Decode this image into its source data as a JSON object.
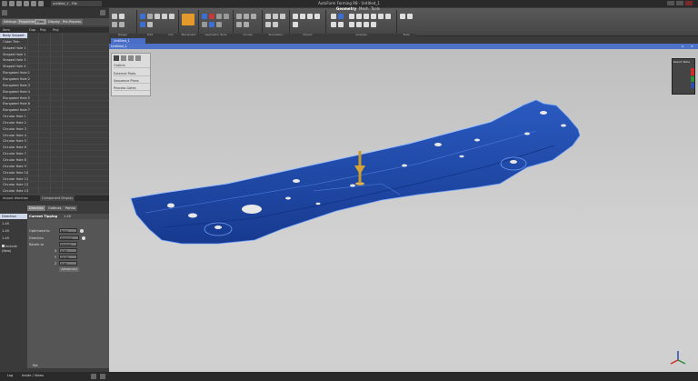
{
  "window": {
    "title": "AutoForm Forming R8 - Untitled_1",
    "quick_tab": "untitled_1 - File"
  },
  "ribbon": {
    "menus": [
      "Geometry",
      "Mesh",
      "Tools"
    ],
    "groups": [
      "Design",
      "Edit",
      "Cut",
      "Placement",
      "Geometric Tools",
      "Curves",
      "Simulation",
      "Import",
      "Analysis",
      "Tools"
    ]
  },
  "left_panel": {
    "tabs": [
      "Settings",
      "Properties",
      "Filter",
      "Display",
      "Pre-Process"
    ],
    "columns": [
      "Item",
      "Gap",
      "Proj",
      "Proj"
    ],
    "tree_items": [
      "Body Subpart 1",
      "Outer Trim",
      "Shaped Hole 1",
      "Shaped Hole 2",
      "Shaped Hole 3",
      "Shaped Hole 4",
      "Elongated Hole 1",
      "Elongated Hole 2",
      "Elongated Hole 3",
      "Elongated Hole 4",
      "Elongated Hole 5",
      "Elongated Hole 6",
      "Elongated Hole 7",
      "Circular Hole 1",
      "Circular Hole 2",
      "Circular Hole 3",
      "Circular Hole 4",
      "Circular Hole 5",
      "Circular Hole 6",
      "Circular Hole 7",
      "Circular Hole 8",
      "Circular Hole 9",
      "Circular Hole 10",
      "Circular Hole 11",
      "Circular Hole 12",
      "Circular Hole 13"
    ],
    "properties_header": "Import direction",
    "properties_tab2": "Component Display",
    "left_labels": [
      "Direction",
      "1-40",
      "1-40",
      "1-40"
    ],
    "visible_label": "Include (New)",
    "subtabs": [
      "Direction",
      "Outlines",
      "Partial"
    ],
    "detail": {
      "section": "Current Tipping",
      "section_value": "1-40",
      "rows": [
        {
          "label": "Optimized to",
          "value": "None"
        },
        {
          "label": "Direction",
          "value": "Drawing Normal"
        },
        {
          "label": "Rotate to",
          "value": "Product"
        },
        {
          "label": "X",
          "value": "0.00"
        },
        {
          "label": "Y",
          "value": "12.00"
        },
        {
          "label": "Z",
          "value": "0.00"
        }
      ],
      "button": "Advanced",
      "footer": "Rot"
    }
  },
  "statusbar": {
    "items": [
      "Log",
      "Inside / Views"
    ]
  },
  "viewport": {
    "tab": "Untitled_1",
    "frame_title": "Untitled_1",
    "float_panel_items": [
      "Outline",
      "External Parts",
      "Sequence Plans",
      "Process Gates"
    ],
    "result_widget_label": "Result Table",
    "result_colors": [
      "#d12a2a",
      "#2e8b3a",
      "#2a4fb0",
      "#555555"
    ]
  },
  "colors": {
    "accent": "#4a6dc8",
    "part": "#1d46a8",
    "arrow": "#c99a2b"
  }
}
